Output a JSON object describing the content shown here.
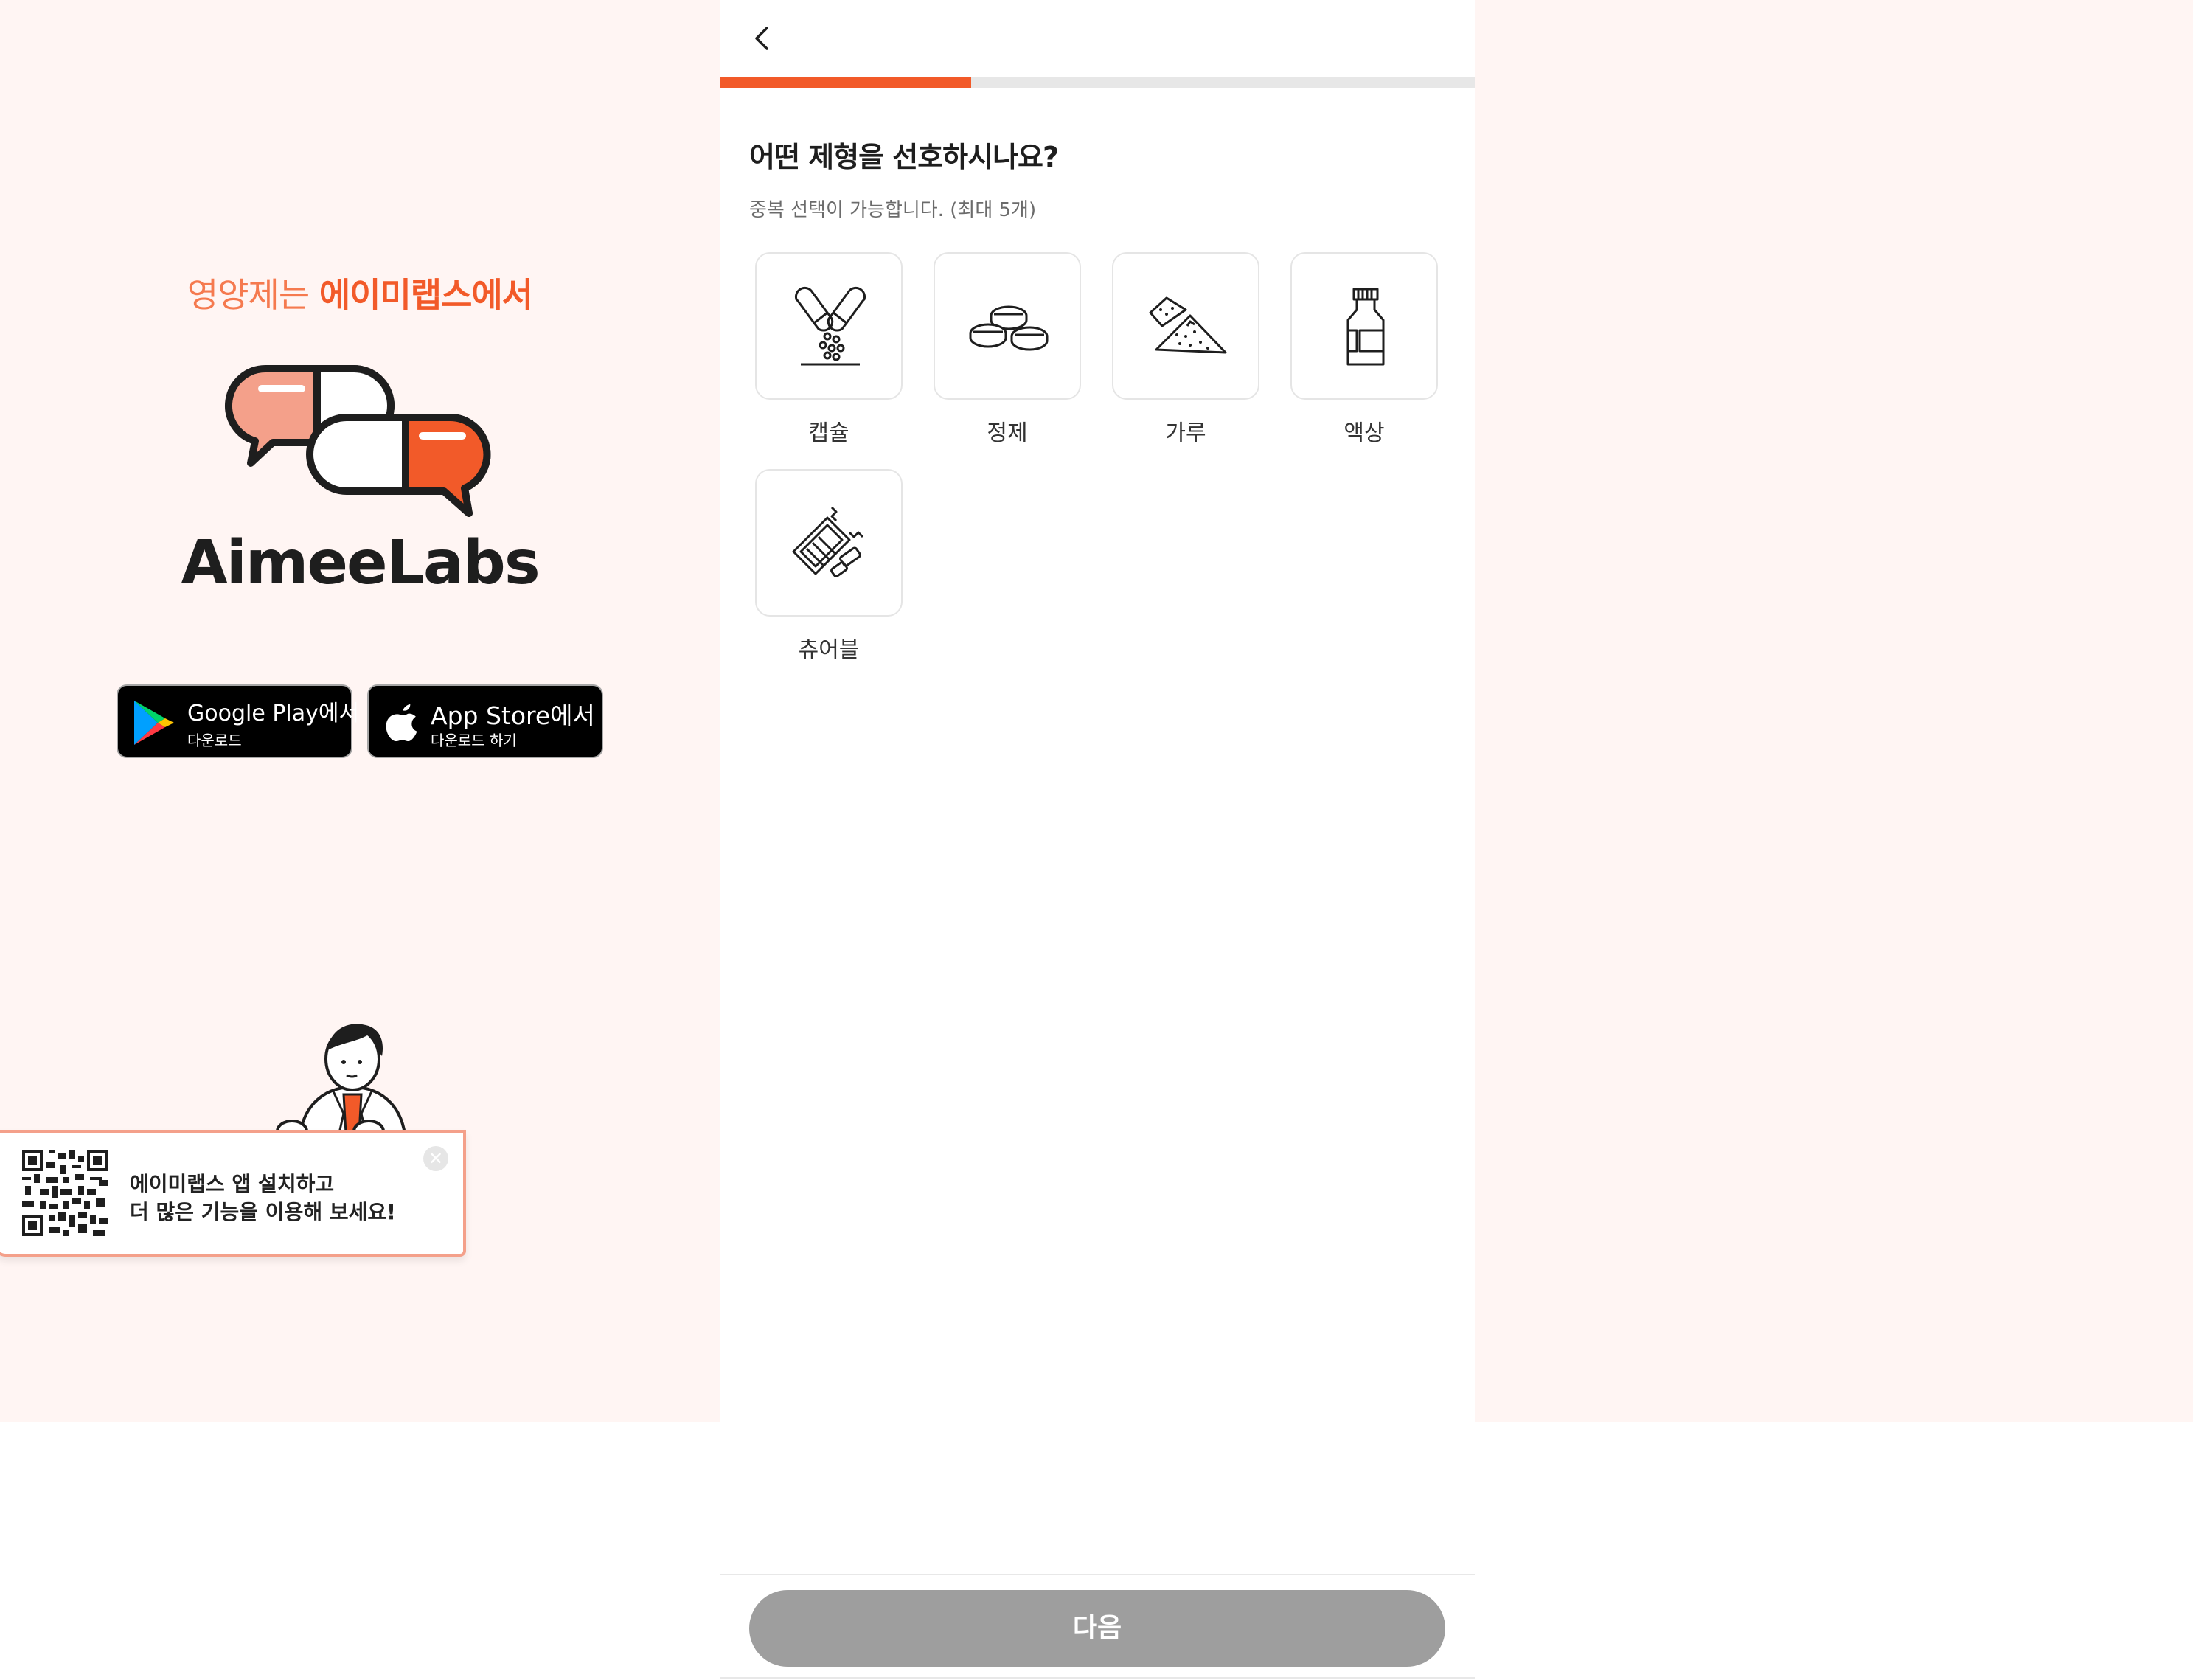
{
  "left_panel": {
    "tagline_regular": "영양제는 ",
    "tagline_bold": "에이미랩스에서",
    "brand_name": "AimeeLabs",
    "google_play": {
      "main": "Google Play에서",
      "sub": "다운로드"
    },
    "app_store": {
      "main": "App Store에서",
      "sub": "다운로드 하기"
    },
    "promo": {
      "line1": "에이미랩스 앱 설치하고",
      "line2": "더 많은 기능을 이용해 보세요!",
      "close_icon": "close-icon"
    }
  },
  "survey": {
    "progress": 0.333,
    "question": "어떤 제형을 선호하시나요?",
    "hint": "중복 선택이 가능합니다. (최대 5개)",
    "options": [
      {
        "label": "캡슐",
        "icon": "capsule-icon"
      },
      {
        "label": "정제",
        "icon": "tablet-icon"
      },
      {
        "label": "가루",
        "icon": "powder-icon"
      },
      {
        "label": "액상",
        "icon": "liquid-bottle-icon"
      },
      {
        "label": "츄어블",
        "icon": "chewable-icon"
      }
    ],
    "next_label": "다음"
  },
  "colors": {
    "accent": "#f25a29",
    "accent_light": "#f5a08a",
    "panel_bg": "#fff5f3",
    "disabled_button": "#9e9e9e"
  }
}
